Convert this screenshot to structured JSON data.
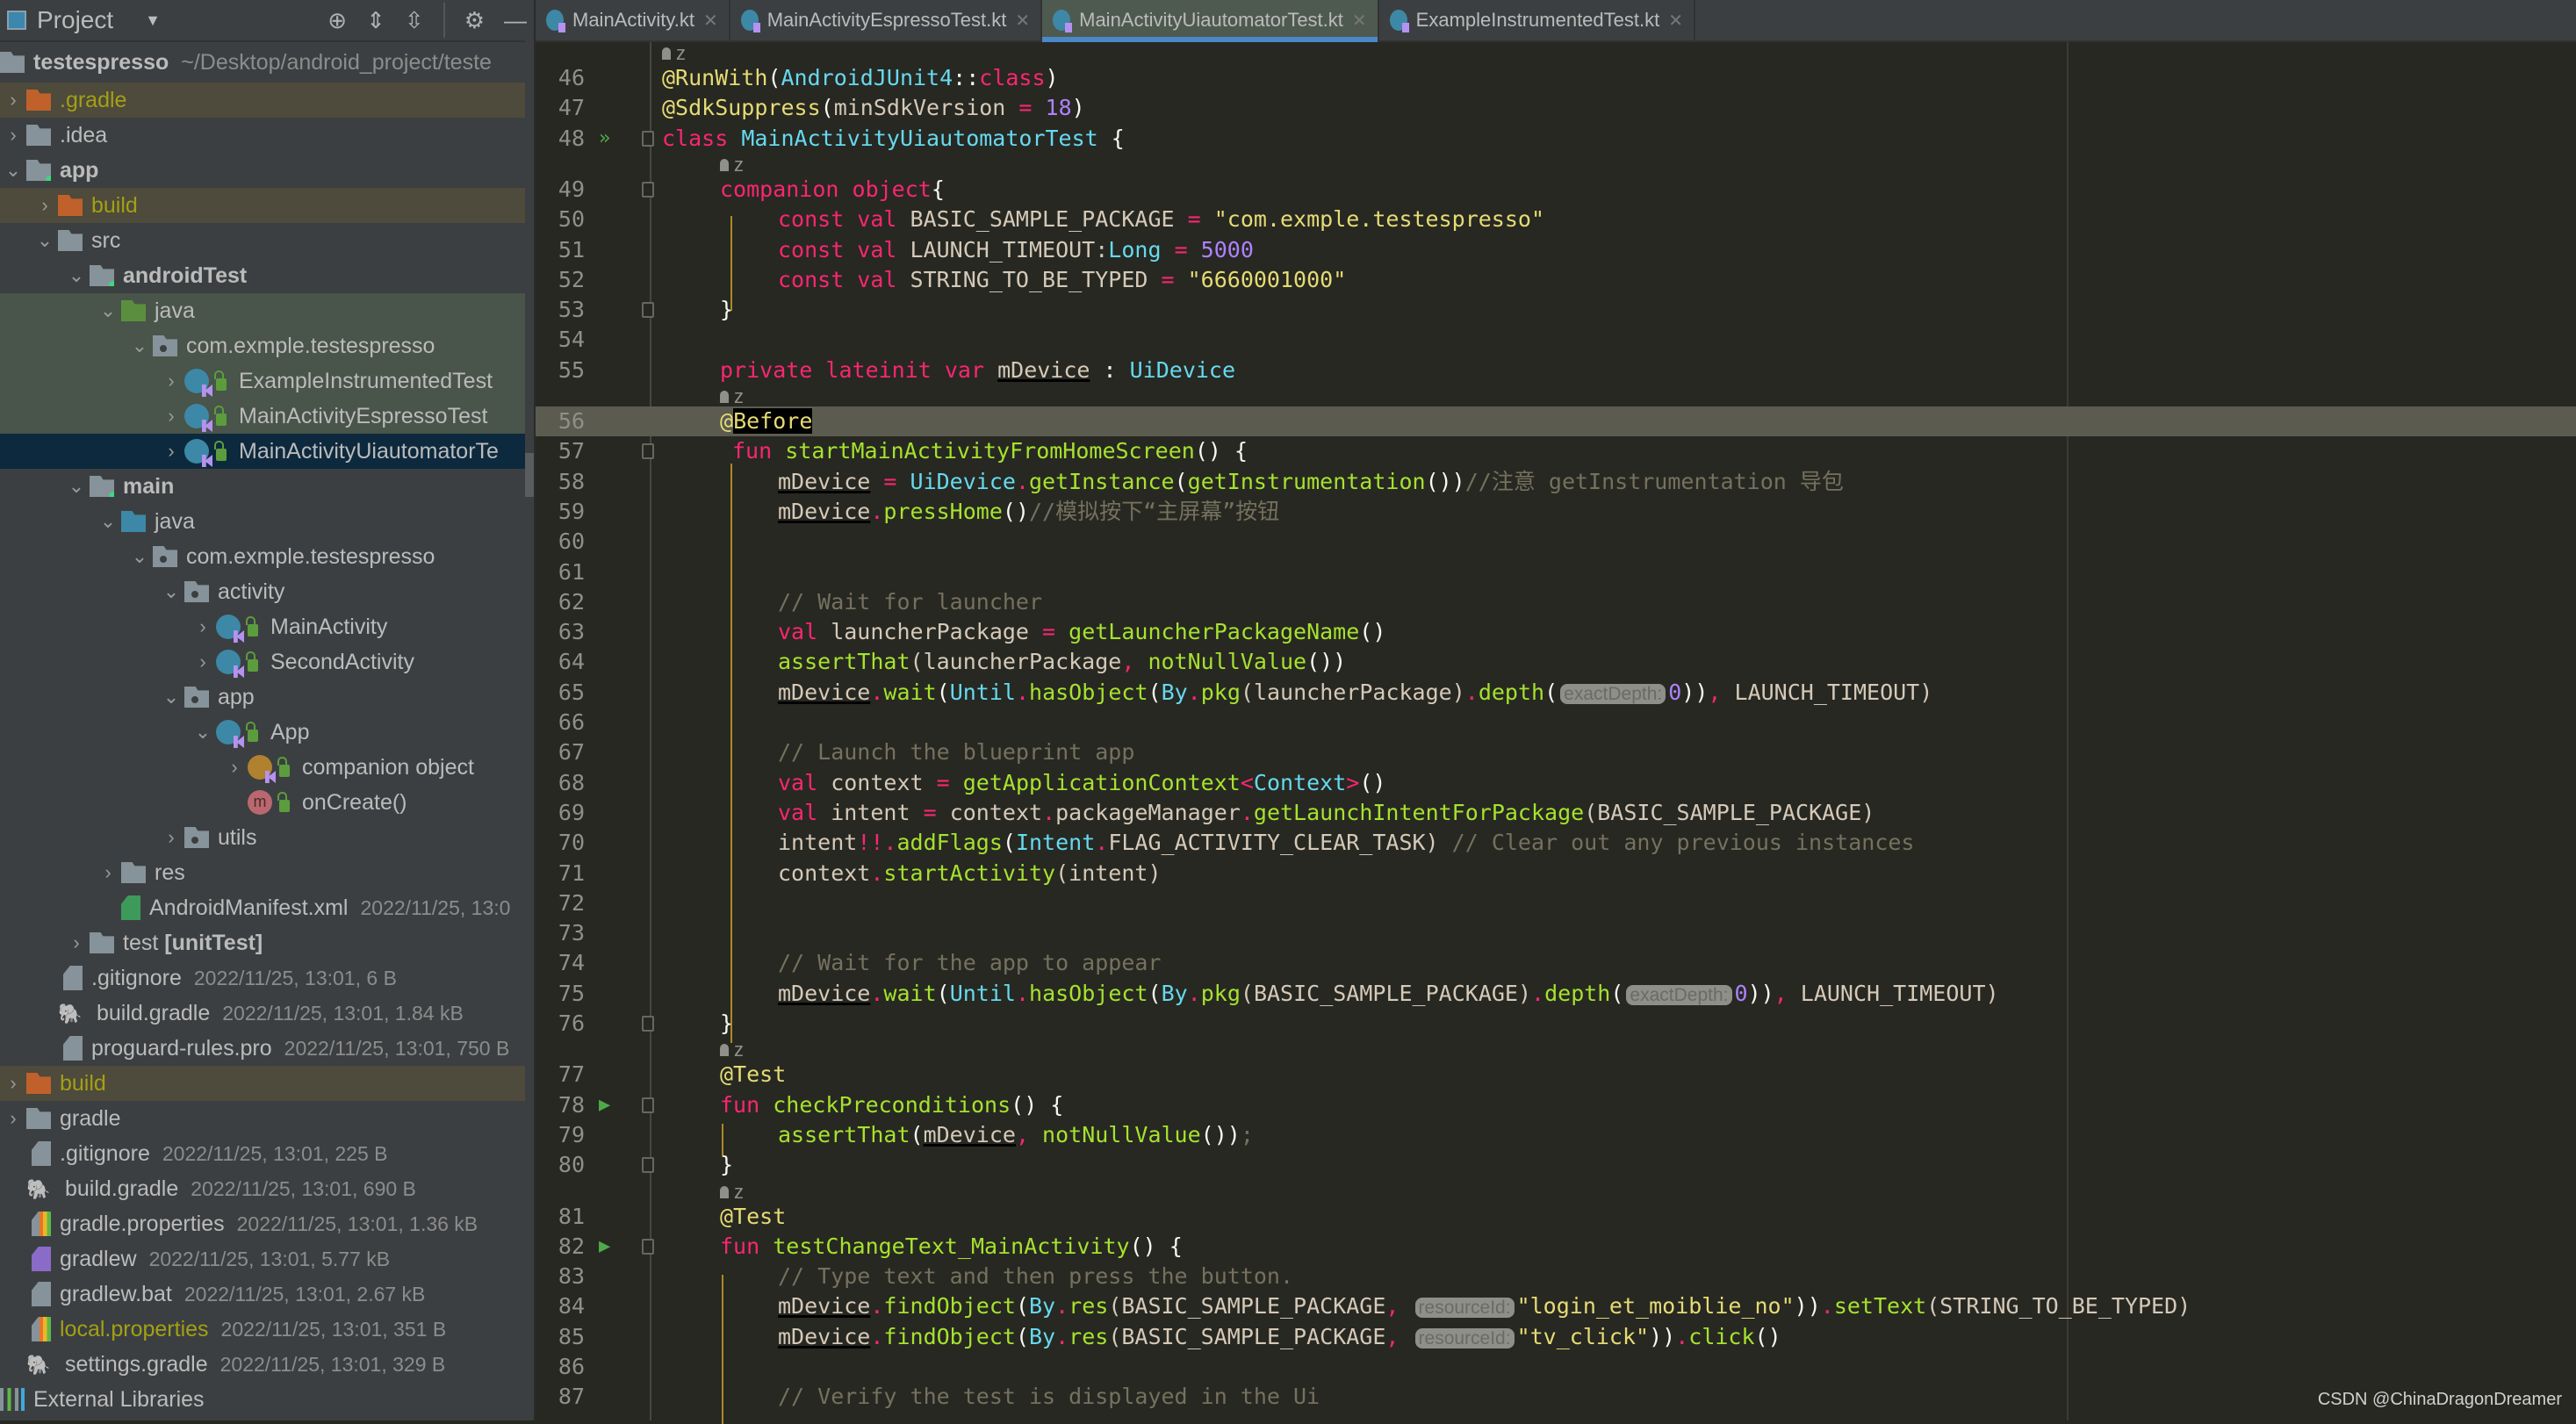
{
  "sidebar": {
    "title": "Project",
    "tools": [
      "locate-icon",
      "expand-all-icon",
      "collapse-all-icon",
      "gear-icon",
      "minimize-icon"
    ],
    "root": {
      "name": "testespresso",
      "path": "~/Desktop/android_project/teste"
    },
    "items": [
      {
        "label": ".gradle",
        "meta": ""
      },
      {
        "label": ".idea",
        "meta": ""
      },
      {
        "label": "app",
        "meta": ""
      },
      {
        "label": "build",
        "meta": ""
      },
      {
        "label": "src",
        "meta": ""
      },
      {
        "label": "androidTest",
        "meta": ""
      },
      {
        "label": "java",
        "meta": ""
      },
      {
        "label": "com.exmple.testespresso",
        "meta": ""
      },
      {
        "label": "ExampleInstrumentedTest",
        "meta": ""
      },
      {
        "label": "MainActivityEspressoTest",
        "meta": ""
      },
      {
        "label": "MainActivityUiautomatorTe",
        "meta": ""
      },
      {
        "label": "main",
        "meta": ""
      },
      {
        "label": "java",
        "meta": ""
      },
      {
        "label": "com.exmple.testespresso",
        "meta": ""
      },
      {
        "label": "activity",
        "meta": ""
      },
      {
        "label": "MainActivity",
        "meta": ""
      },
      {
        "label": "SecondActivity",
        "meta": ""
      },
      {
        "label": "app",
        "meta": ""
      },
      {
        "label": "App",
        "meta": ""
      },
      {
        "label": "companion object",
        "meta": ""
      },
      {
        "label": "onCreate()",
        "meta": ""
      },
      {
        "label": "utils",
        "meta": ""
      },
      {
        "label": "res",
        "meta": ""
      },
      {
        "label": "AndroidManifest.xml",
        "meta": "2022/11/25, 13:0"
      },
      {
        "label": "test",
        "label_suffix": "[unitTest]",
        "meta": ""
      },
      {
        "label": ".gitignore",
        "meta": "2022/11/25, 13:01, 6 B"
      },
      {
        "label": "build.gradle",
        "meta": "2022/11/25, 13:01, 1.84 kB"
      },
      {
        "label": "proguard-rules.pro",
        "meta": "2022/11/25, 13:01, 750 B"
      },
      {
        "label": "build",
        "meta": ""
      },
      {
        "label": "gradle",
        "meta": ""
      },
      {
        "label": ".gitignore",
        "meta": "2022/11/25, 13:01, 225 B"
      },
      {
        "label": "build.gradle",
        "meta": "2022/11/25, 13:01, 690 B"
      },
      {
        "label": "gradle.properties",
        "meta": "2022/11/25, 13:01, 1.36 kB"
      },
      {
        "label": "gradlew",
        "meta": "2022/11/25, 13:01, 5.77 kB"
      },
      {
        "label": "gradlew.bat",
        "meta": "2022/11/25, 13:01, 2.67 kB"
      },
      {
        "label": "local.properties",
        "meta": "2022/11/25, 13:01, 351 B"
      },
      {
        "label": "settings.gradle",
        "meta": "2022/11/25, 13:01, 329 B"
      },
      {
        "label": "External Libraries",
        "meta": ""
      }
    ]
  },
  "tabs": [
    {
      "label": "MainActivity.kt",
      "active": false
    },
    {
      "label": "MainActivityEspressoTest.kt",
      "active": false
    },
    {
      "label": "MainActivityUiautomatorTest.kt",
      "active": true
    },
    {
      "label": "ExampleInstrumentedTest.kt",
      "active": false
    }
  ],
  "editor": {
    "author_hint": "z",
    "current_line": 56,
    "lines": {
      "l46": {
        "num": "46",
        "p": [
          "@RunWith",
          "(",
          "AndroidJUnit4",
          "::",
          "class",
          ")"
        ]
      },
      "l47": {
        "num": "47",
        "p": [
          "@SdkSuppress",
          "(",
          "minSdkVersion",
          " = ",
          "18",
          ")"
        ]
      },
      "l48": {
        "num": "48",
        "p": [
          "class",
          " ",
          "MainActivityUiautomatorTest",
          " {"
        ]
      },
      "l49": {
        "num": "49",
        "p": [
          "companion object",
          "{"
        ]
      },
      "l50": {
        "num": "50",
        "p": [
          "const val",
          " BASIC_SAMPLE_PACKAGE ",
          "=",
          " ",
          "\"com.exmple.testespresso\""
        ]
      },
      "l51": {
        "num": "51",
        "p": [
          "const val",
          " LAUNCH_TIMEOUT:",
          "Long",
          " = ",
          "5000"
        ]
      },
      "l52": {
        "num": "52",
        "p": [
          "const val",
          " STRING_TO_BE_TYPED ",
          "=",
          " ",
          "\"6660001000\""
        ]
      },
      "l53": {
        "num": "53",
        "p": [
          "}"
        ]
      },
      "l54": {
        "num": "54",
        "p": []
      },
      "l55": {
        "num": "55",
        "p": [
          "private lateinit var",
          " ",
          "mDevice",
          " : ",
          "UiDevice"
        ]
      },
      "l56": {
        "num": "56",
        "p": [
          "@",
          "Before"
        ]
      },
      "l57": {
        "num": "57",
        "p": [
          "fun",
          " ",
          "startMainActivityFromHomeScreen",
          "() {"
        ]
      },
      "l58": {
        "num": "58",
        "p": [
          "mDevice",
          " = ",
          "UiDevice",
          ".",
          "getInstance",
          "(",
          "getInstrumentation",
          "())",
          "//注意 getInstrumentation 导包"
        ]
      },
      "l59": {
        "num": "59",
        "p": [
          "mDevice",
          ".",
          "pressHome",
          "()",
          "//模拟按下“主屏幕”按钮"
        ]
      },
      "l60": {
        "num": "60",
        "p": []
      },
      "l61": {
        "num": "61",
        "p": []
      },
      "l62": {
        "num": "62",
        "p": [
          "// Wait for launcher"
        ]
      },
      "l63": {
        "num": "63",
        "p": [
          "val",
          " launcherPackage ",
          "=",
          " ",
          "getLauncherPackageName",
          "()"
        ]
      },
      "l64": {
        "num": "64",
        "p": [
          "assertThat",
          "(launcherPackage",
          ", ",
          "notNullValue",
          "())"
        ]
      },
      "l65": {
        "num": "65",
        "p": [
          "mDevice",
          ".",
          "wait",
          "(",
          "Until",
          ".",
          "hasObject",
          "(",
          "By",
          ".",
          "pkg",
          "(launcherPackage)",
          ".",
          "depth",
          "(",
          "exactDepth:",
          "0",
          "))",
          ", ",
          "LAUNCH_TIMEOUT)"
        ]
      },
      "l66": {
        "num": "66",
        "p": []
      },
      "l67": {
        "num": "67",
        "p": [
          "// Launch the blueprint app"
        ]
      },
      "l68": {
        "num": "68",
        "p": [
          "val",
          " context ",
          "=",
          " ",
          "getApplicationContext",
          "<",
          "Context",
          ">",
          "()"
        ]
      },
      "l69": {
        "num": "69",
        "p": [
          "val",
          " intent ",
          "=",
          " context",
          ".",
          "packageManager",
          ".",
          "getLaunchIntentForPackage",
          "(BASIC_SAMPLE_PACKAGE)"
        ]
      },
      "l70": {
        "num": "70",
        "p": [
          "intent",
          "!!.",
          "addFlags",
          "(",
          "Intent",
          ".",
          "FLAG_ACTIVITY_CLEAR_TASK) ",
          "// Clear out any previous instances"
        ]
      },
      "l71": {
        "num": "71",
        "p": [
          "context",
          ".",
          "startActivity",
          "(intent)"
        ]
      },
      "l72": {
        "num": "72",
        "p": []
      },
      "l73": {
        "num": "73",
        "p": []
      },
      "l74": {
        "num": "74",
        "p": [
          "// Wait for the app to appear"
        ]
      },
      "l75": {
        "num": "75",
        "p": [
          "mDevice",
          ".",
          "wait",
          "(",
          "Until",
          ".",
          "hasObject",
          "(",
          "By",
          ".",
          "pkg",
          "(BASIC_SAMPLE_PACKAGE)",
          ".",
          "depth",
          "(",
          "exactDepth:",
          "0",
          "))",
          ", ",
          "LAUNCH_TIMEOUT)"
        ]
      },
      "l76": {
        "num": "76",
        "p": [
          "}"
        ]
      },
      "l77": {
        "num": "77",
        "p": [
          "@Test"
        ]
      },
      "l78": {
        "num": "78",
        "p": [
          "fun",
          " ",
          "checkPreconditions",
          "() {"
        ]
      },
      "l79": {
        "num": "79",
        "p": [
          "assertThat",
          "(",
          "mDevice",
          ", ",
          "notNullValue",
          "())",
          ";"
        ]
      },
      "l80": {
        "num": "80",
        "p": [
          "}"
        ]
      },
      "l81": {
        "num": "81",
        "p": [
          "@Test"
        ]
      },
      "l82": {
        "num": "82",
        "p": [
          "fun",
          " ",
          "testChangeText_MainActivity",
          "() {"
        ]
      },
      "l83": {
        "num": "83",
        "p": [
          "// Type text and then press the button."
        ]
      },
      "l84": {
        "num": "84",
        "p": [
          "mDevice",
          ".",
          "findObject",
          "(",
          "By",
          ".",
          "res",
          "(BASIC_SAMPLE_PACKAGE",
          ", ",
          "resourceId:",
          "\"login_et_moiblie_no\"",
          "))",
          ".",
          "setText",
          "(STRING_TO_BE_TYPED)"
        ]
      },
      "l85": {
        "num": "85",
        "p": [
          "mDevice",
          ".",
          "findObject",
          "(",
          "By",
          ".",
          "res",
          "(BASIC_SAMPLE_PACKAGE",
          ", ",
          "resourceId:",
          "\"tv_click\"",
          "))",
          ".",
          "click",
          "()"
        ]
      },
      "l86": {
        "num": "86",
        "p": []
      },
      "l87": {
        "num": "87",
        "p": [
          "// Verify the test is displayed in the Ui"
        ]
      }
    }
  },
  "watermark": "CSDN @ChinaDragonDreamer",
  "colors": {
    "keyword": "#f92672",
    "type": "#66d9ef",
    "function": "#a6e22e",
    "string": "#e6db74",
    "number": "#ae81ff",
    "comment": "#75715e",
    "active_tab_underline": "#4a88c7",
    "selection": "#0d293e"
  }
}
